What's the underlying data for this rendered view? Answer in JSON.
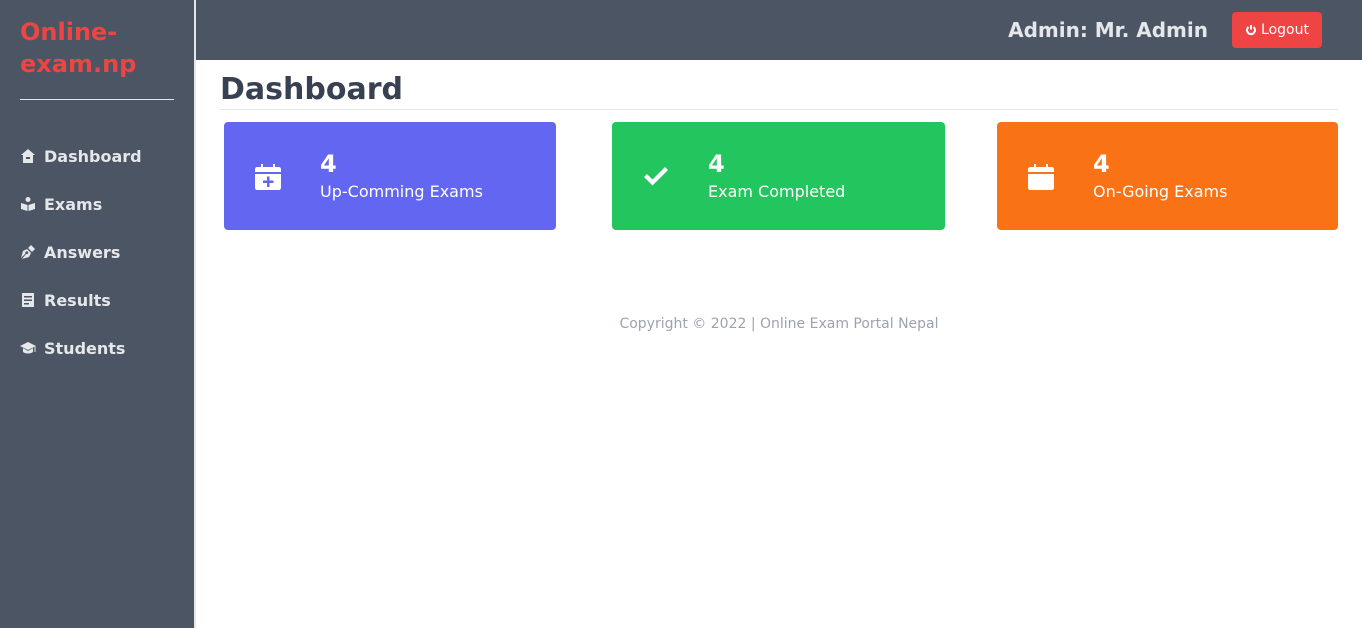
{
  "sidebar": {
    "brand": "Online-exam.np",
    "items": [
      {
        "label": "Dashboard",
        "icon": "home-icon"
      },
      {
        "label": "Exams",
        "icon": "book-reader-icon"
      },
      {
        "label": "Answers",
        "icon": "pen-nib-icon"
      },
      {
        "label": "Results",
        "icon": "file-list-icon"
      },
      {
        "label": "Students",
        "icon": "graduation-cap-icon"
      }
    ]
  },
  "header": {
    "admin_label": "Admin: Mr. Admin",
    "logout_label": "Logout"
  },
  "main": {
    "title": "Dashboard",
    "cards": [
      {
        "value": "4",
        "label": "Up-Comming Exams",
        "icon": "calendar-plus-icon",
        "color": "#6366f1"
      },
      {
        "value": "4",
        "label": "Exam Completed",
        "icon": "check-icon",
        "color": "#22c55e"
      },
      {
        "value": "4",
        "label": "On-Going Exams",
        "icon": "calendar-icon",
        "color": "#f97316"
      }
    ]
  },
  "footer": {
    "text": "Copyright © 2022 | Online Exam Portal Nepal"
  },
  "colors": {
    "sidebar_bg": "#4b5563",
    "brand": "#ef4444",
    "logout": "#ef4444"
  }
}
